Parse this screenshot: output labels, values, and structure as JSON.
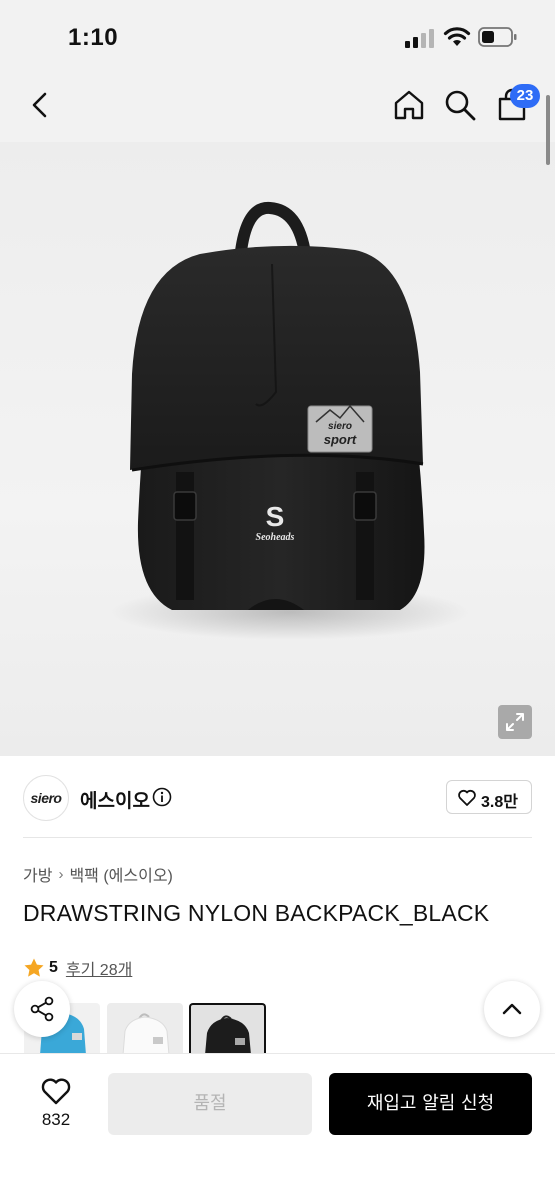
{
  "status_bar": {
    "time": "1:10"
  },
  "header": {
    "cart_count": "23"
  },
  "product_image": {
    "patch_brand": "siero",
    "patch_text": "sport",
    "bag_logo": "Seoheads"
  },
  "seller": {
    "avatar_text": "siero",
    "name": "에스이오",
    "like_count": "3.8만"
  },
  "breadcrumb": [
    "가방",
    "백팩 (에스이오)"
  ],
  "product": {
    "title": "DRAWSTRING NYLON BACKPACK_BLACK",
    "rating": "5",
    "review_link": "후기 28개"
  },
  "bottom_bar": {
    "wish_count": "832",
    "soldout_label": "품절",
    "restock_label": "재입고 알림 신청"
  },
  "colors": {
    "badge": "#2e6cf6",
    "star": "#f5a623",
    "thumb_blue": "#3aa8d8"
  }
}
